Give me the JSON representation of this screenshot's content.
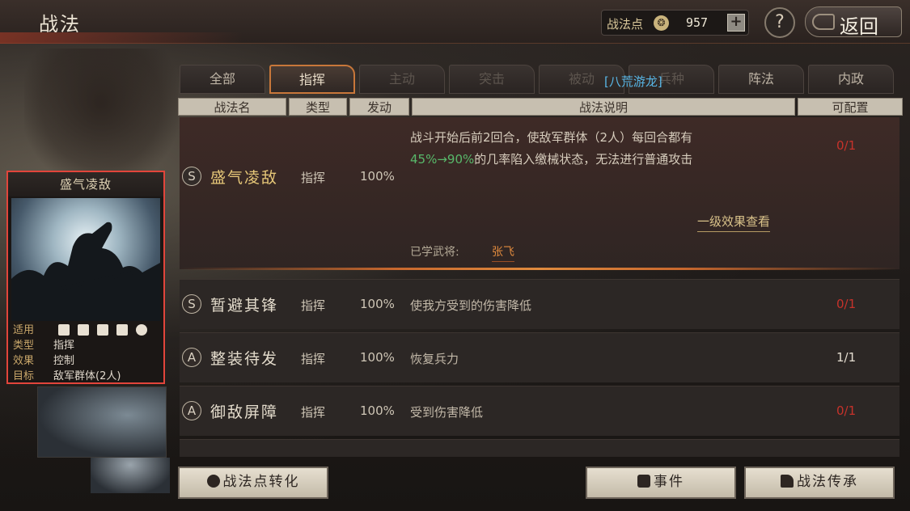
{
  "header": {
    "title": "战法",
    "points_label": "战法点",
    "points_value": "957",
    "plus_label": "+",
    "help_label": "?",
    "back_label": "返回"
  },
  "tabs": [
    {
      "label": "全部"
    },
    {
      "label": "指挥"
    },
    {
      "label": "主动"
    },
    {
      "label": "突击"
    },
    {
      "label": "被动"
    },
    {
      "label": "兵种"
    },
    {
      "label": "阵法"
    },
    {
      "label": "内政"
    }
  ],
  "tab_overlay_text": "[八荒游龙]",
  "columns": {
    "name": "战法名",
    "type": "类型",
    "rate": "发动",
    "desc": "战法说明",
    "slot": "可配置"
  },
  "expanded_row": {
    "grade": "S",
    "name": "盛气凌敌",
    "type": "指挥",
    "rate": "100%",
    "desc_line1": "战斗开始后前2回合，使敌军群体（2人）每回合都有",
    "desc_pct": "45%→90%",
    "desc_line2_rest": "的几率陷入缴械状态，无法进行普通攻击",
    "slot": "0/1",
    "effect_link": "一级效果查看",
    "learned_label": "已学武将:",
    "learned_name": "张飞"
  },
  "rows": [
    {
      "grade": "S",
      "name": "暂避其锋",
      "type": "指挥",
      "rate": "100%",
      "desc": "使我方受到的伤害降低",
      "slot": "0/1"
    },
    {
      "grade": "A",
      "name": "整装待发",
      "type": "指挥",
      "rate": "100%",
      "desc": "恢复兵力",
      "slot": "1/1"
    },
    {
      "grade": "A",
      "name": "御敌屏障",
      "type": "指挥",
      "rate": "100%",
      "desc": "受到伤害降低",
      "slot": "0/1"
    }
  ],
  "card": {
    "title": "盛气凌敌",
    "apply_key": "适用",
    "type_key": "类型",
    "type_val": "指挥",
    "effect_key": "效果",
    "effect_val": "控制",
    "target_key": "目标",
    "target_val": "敌军群体(2人)"
  },
  "buttons": {
    "convert": "战法点转化",
    "event": "事件",
    "inherit": "战法传承"
  },
  "colors": {
    "accent": "#c8773a",
    "selected_border": "#e2453b",
    "slot_full": "#c6322b",
    "highlight_green": "#58b86a",
    "overlay_blue": "#58b6e6"
  }
}
